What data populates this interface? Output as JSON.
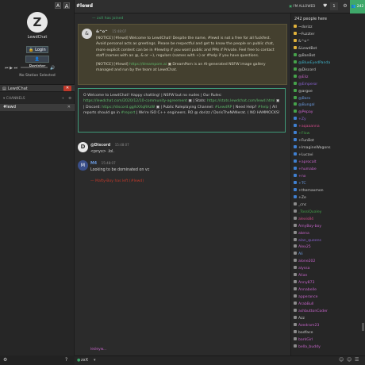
{
  "sidebar": {
    "avatar_letter": "Z",
    "site_name": "LewdChat",
    "login_label": "Login",
    "register_label": "Register",
    "station_label": "No Station Selected",
    "network_label": "LewdChat",
    "channels_label": "CHANNELS",
    "active_channel": "#lewd"
  },
  "topbar": {
    "font_small": "A",
    "font_large": "A",
    "channel": "#lewd",
    "allowed_label": "I'M ALLOWED",
    "heart_count": "",
    "user_count_badge": "1",
    "people_count_badge": "242"
  },
  "messages": {
    "joined": "— zxX has joined",
    "notice_sender": "&^o^",
    "notice_time": "15:48:07",
    "notice_line1": "[NOTICE] [#lewd] Welcome to LewdChat! Despite the name, #lewd is not a free for all fuckfest. Avoid personal acts as greetings. Please be respectful and get to know the people on public chat, more explicit content can be in #lewdrp if you want public and PMs if Private. Feel free to contact staff (names with an @, & or ~), regulars (names with +) or #help if you have questions.",
    "notice_line2_pre": "[NOTICE] [#lewd]",
    "notice_link": "https://dreampom.ai",
    "notice_line2_post": "DreamPorn is an AI-generated NSFW image gallery managed and run by the team at LewdChat.",
    "motd_text": "O Welcome to LewdChat! Happy chatting! | NSFW but no nudes | Our Rules:",
    "motd_link1": "https://lewdchat.com/2020/12/10-community-agreement",
    "motd_mid1": "| Stats:",
    "motd_link2": "https://stats.lewdchat.com/lewd.html",
    "motd_mid2": "| Discord:",
    "motd_link3": "https://discord.gg/kXXqRAzW",
    "motd_mid3": "| Public Roleplaying Channel:",
    "motd_chan1": "#LewdRP",
    "motd_mid4": "| Need Help?",
    "motd_chan2": "#help",
    "motd_mid5": "| All reports should go in",
    "motd_chan3": "#report",
    "motd_end": "| We're ISO C++ engineers. RO @ dorizz / DorisTheNANerat. ( NO HAMMOCKS!",
    "m1_avatar": "D",
    "m1_name": "@Discord",
    "m1_time": "15:48:07",
    "m1_text": "<pnyx> .lol.",
    "m2_avatar": "M",
    "m2_name": "M4",
    "m2_time": "15:48:07",
    "m2_text": "Looking to be dominated on vc",
    "m3_text": "— Mafty-Boy has left (#lewd)",
    "typing": "lesleyw..."
  },
  "users": {
    "header": "242 people here",
    "list": [
      {
        "name": "~dorizz",
        "color": "#c9c9c9",
        "dot": "#e0b13a"
      },
      {
        "name": "~Fuzzter",
        "color": "#c9c9c9",
        "dot": "#e0b13a"
      },
      {
        "name": "&^o^",
        "color": "#c9c9c9",
        "dot": "#e0b13a"
      },
      {
        "name": "&LewdBot",
        "color": "#c9c9c9",
        "dot": "#e0b13a"
      },
      {
        "name": "@BanBot",
        "color": "#c9c9c9",
        "dot": "#45a14a"
      },
      {
        "name": "@BlueEyedPanda",
        "color": "#3fb0c6",
        "dot": "#45a14a"
      },
      {
        "name": "@Discord",
        "color": "#c9c9c9",
        "dot": "#45a14a"
      },
      {
        "name": "@Eliz",
        "color": "#c564c9",
        "dot": "#45a14a"
      },
      {
        "name": "@Emperor",
        "color": "#8a63d2",
        "dot": "#45a14a"
      },
      {
        "name": "@argoe",
        "color": "#c9c9c9",
        "dot": "#45a14a"
      },
      {
        "name": "@Baro",
        "color": "#6b9be0",
        "dot": "#45a14a"
      },
      {
        "name": "@Bungal",
        "color": "#6b9be0",
        "dot": "#45a14a"
      },
      {
        "name": "@Pepay",
        "color": "#c564c9",
        "dot": "#45a14a"
      },
      {
        "name": "+Zy",
        "color": "#8a63d2",
        "dot": "#3f7fd0"
      },
      {
        "name": "+aqaaanna",
        "color": "#d04a88",
        "dot": "#3f7fd0"
      },
      {
        "name": "+Flow",
        "color": "#45a14a",
        "dot": "#3f7fd0"
      },
      {
        "name": "+FunBot",
        "color": "#c9c9c9",
        "dot": "#3f7fd0"
      },
      {
        "name": "+ImagineWagons",
        "color": "#c9c9c9",
        "dot": "#3f7fd0"
      },
      {
        "name": "+Lucavi",
        "color": "#c9c9c9",
        "dot": "#3f7fd0"
      },
      {
        "name": "+aprocalt",
        "color": "#c564c9",
        "dot": "#3f7fd0"
      },
      {
        "name": "+humabe",
        "color": "#c564c9",
        "dot": "#3f7fd0"
      },
      {
        "name": "+nx",
        "color": "#c564c9",
        "dot": "#3f7fd0"
      },
      {
        "name": "+TC",
        "color": "#6b9be0",
        "dot": "#3f7fd0"
      },
      {
        "name": "+themaxmon",
        "color": "#c9c9c9",
        "dot": "#3f7fd0"
      },
      {
        "name": "+Ze",
        "color": "#c9c9c9",
        "dot": "#3f7fd0"
      },
      {
        "name": "_cnc",
        "color": "#c9c9c9",
        "dot": "#8a8a8a"
      },
      {
        "name": "_TossiQualey",
        "color": "#45a14a",
        "dot": "#8a8a8a"
      },
      {
        "name": "alexis84",
        "color": "#d04a88",
        "dot": "#8a8a8a"
      },
      {
        "name": "AmyBoy-boy",
        "color": "#c564c9",
        "dot": "#8a8a8a"
      },
      {
        "name": "akena",
        "color": "#c564c9",
        "dot": "#8a8a8a"
      },
      {
        "name": "alan_queens",
        "color": "#8a63d2",
        "dot": "#8a8a8a"
      },
      {
        "name": "Alex25",
        "color": "#c564c9",
        "dot": "#8a8a8a"
      },
      {
        "name": "Ali",
        "color": "#6b9be0",
        "dot": "#8a8a8a"
      },
      {
        "name": "alone202",
        "color": "#c564c9",
        "dot": "#8a8a8a"
      },
      {
        "name": "alyssa",
        "color": "#c564c9",
        "dot": "#8a8a8a"
      },
      {
        "name": "Alian",
        "color": "#c564c9",
        "dot": "#8a8a8a"
      },
      {
        "name": "Anny873",
        "color": "#c564c9",
        "dot": "#8a8a8a"
      },
      {
        "name": "Annabelle",
        "color": "#c564c9",
        "dot": "#8a8a8a"
      },
      {
        "name": "apperance",
        "color": "#c564c9",
        "dot": "#8a8a8a"
      },
      {
        "name": "ArabBull",
        "color": "#c564c9",
        "dot": "#8a8a8a"
      },
      {
        "name": "ashbuttonCoder",
        "color": "#c564c9",
        "dot": "#8a8a8a"
      },
      {
        "name": "Azz",
        "color": "#c9c9c9",
        "dot": "#8a8a8a"
      },
      {
        "name": "Azedram23",
        "color": "#c564c9",
        "dot": "#8a8a8a"
      },
      {
        "name": "badface",
        "color": "#c9c9c9",
        "dot": "#8a8a8a"
      },
      {
        "name": "barkGirl",
        "color": "#c564c9",
        "dot": "#8a8a8a"
      },
      {
        "name": "bella_buddy",
        "color": "#c564c9",
        "dot": "#8a8a8a"
      }
    ]
  },
  "input": {
    "nick": "zxX"
  },
  "colors": {
    "accent": "#3fa86a",
    "notice_bg": "#44402f",
    "motd_border": "#3f9a78"
  }
}
